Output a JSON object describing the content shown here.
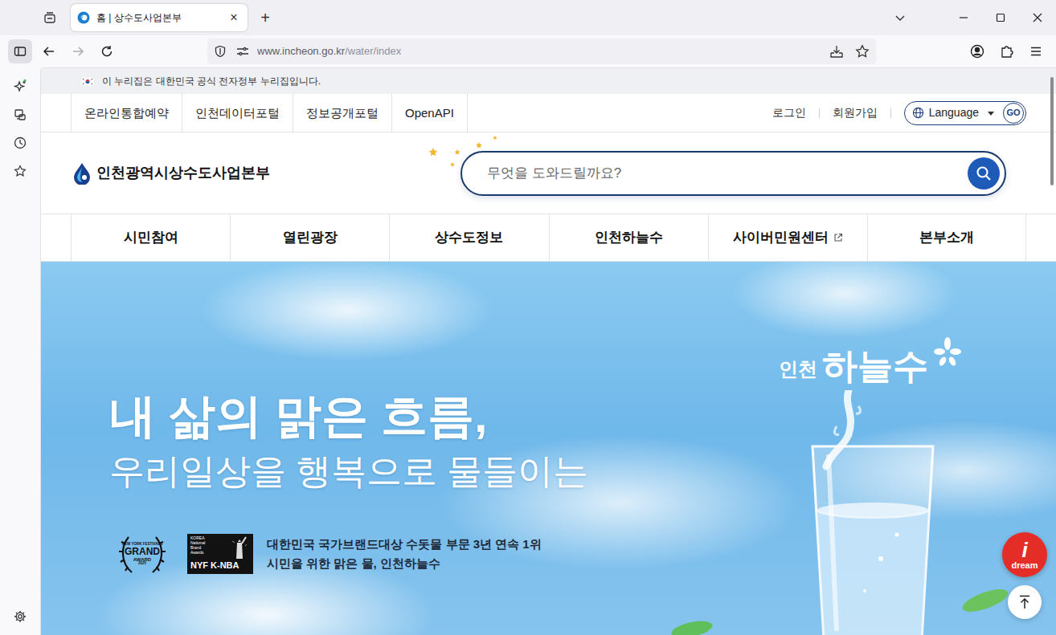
{
  "browser": {
    "tab": {
      "title": "홈 | 상수도사업본부",
      "selected": true,
      "close": "×"
    },
    "new_tab": "+",
    "address": {
      "host": "www.incheon.go.kr",
      "path": "/water/index"
    },
    "forward_disabled": true
  },
  "gov_banner": {
    "text": "이 누리집은 대한민국 공식 전자정부 누리집입니다."
  },
  "utility": {
    "links": [
      "온라인통합예약",
      "인천데이터포털",
      "정보공개포털",
      "OpenAPI"
    ],
    "account": [
      "로그인",
      "회원가입"
    ],
    "language": {
      "label": "Language",
      "button": "GO"
    }
  },
  "header": {
    "logo": "인천광역시상수도사업본부",
    "search": {
      "placeholder": "무엇을 도와드릴까요?"
    }
  },
  "main_nav": [
    {
      "label": "시민참여",
      "external": false
    },
    {
      "label": "열린광장",
      "external": false
    },
    {
      "label": "상수도정보",
      "external": false
    },
    {
      "label": "인천하늘수",
      "external": false
    },
    {
      "label": "사이버민원센터",
      "external": true
    },
    {
      "label": "본부소개",
      "external": false
    }
  ],
  "hero": {
    "headline": "내 삶의 맑은 흐름,",
    "subline": "우리일상을 행복으로 물들이는",
    "badges": [
      {
        "kind": "laurel",
        "lines": [
          "NEW YORK FESTIVALS",
          "GRAND",
          "AWARD",
          "2025"
        ]
      },
      {
        "kind": "square",
        "lines": [
          "KOREA",
          "National",
          "Brand",
          "Awards",
          "NYF K-NBA"
        ]
      }
    ],
    "award_lines": [
      "대한민국 국가브랜드대상 수돗물 부문 3년 연속 1위",
      "시민을 위한 맑은 물, 인천하늘수"
    ],
    "brand": {
      "small": "인천",
      "big": "하늘수"
    }
  },
  "floating": {
    "dream": {
      "letter": "i",
      "label": "dream"
    }
  }
}
